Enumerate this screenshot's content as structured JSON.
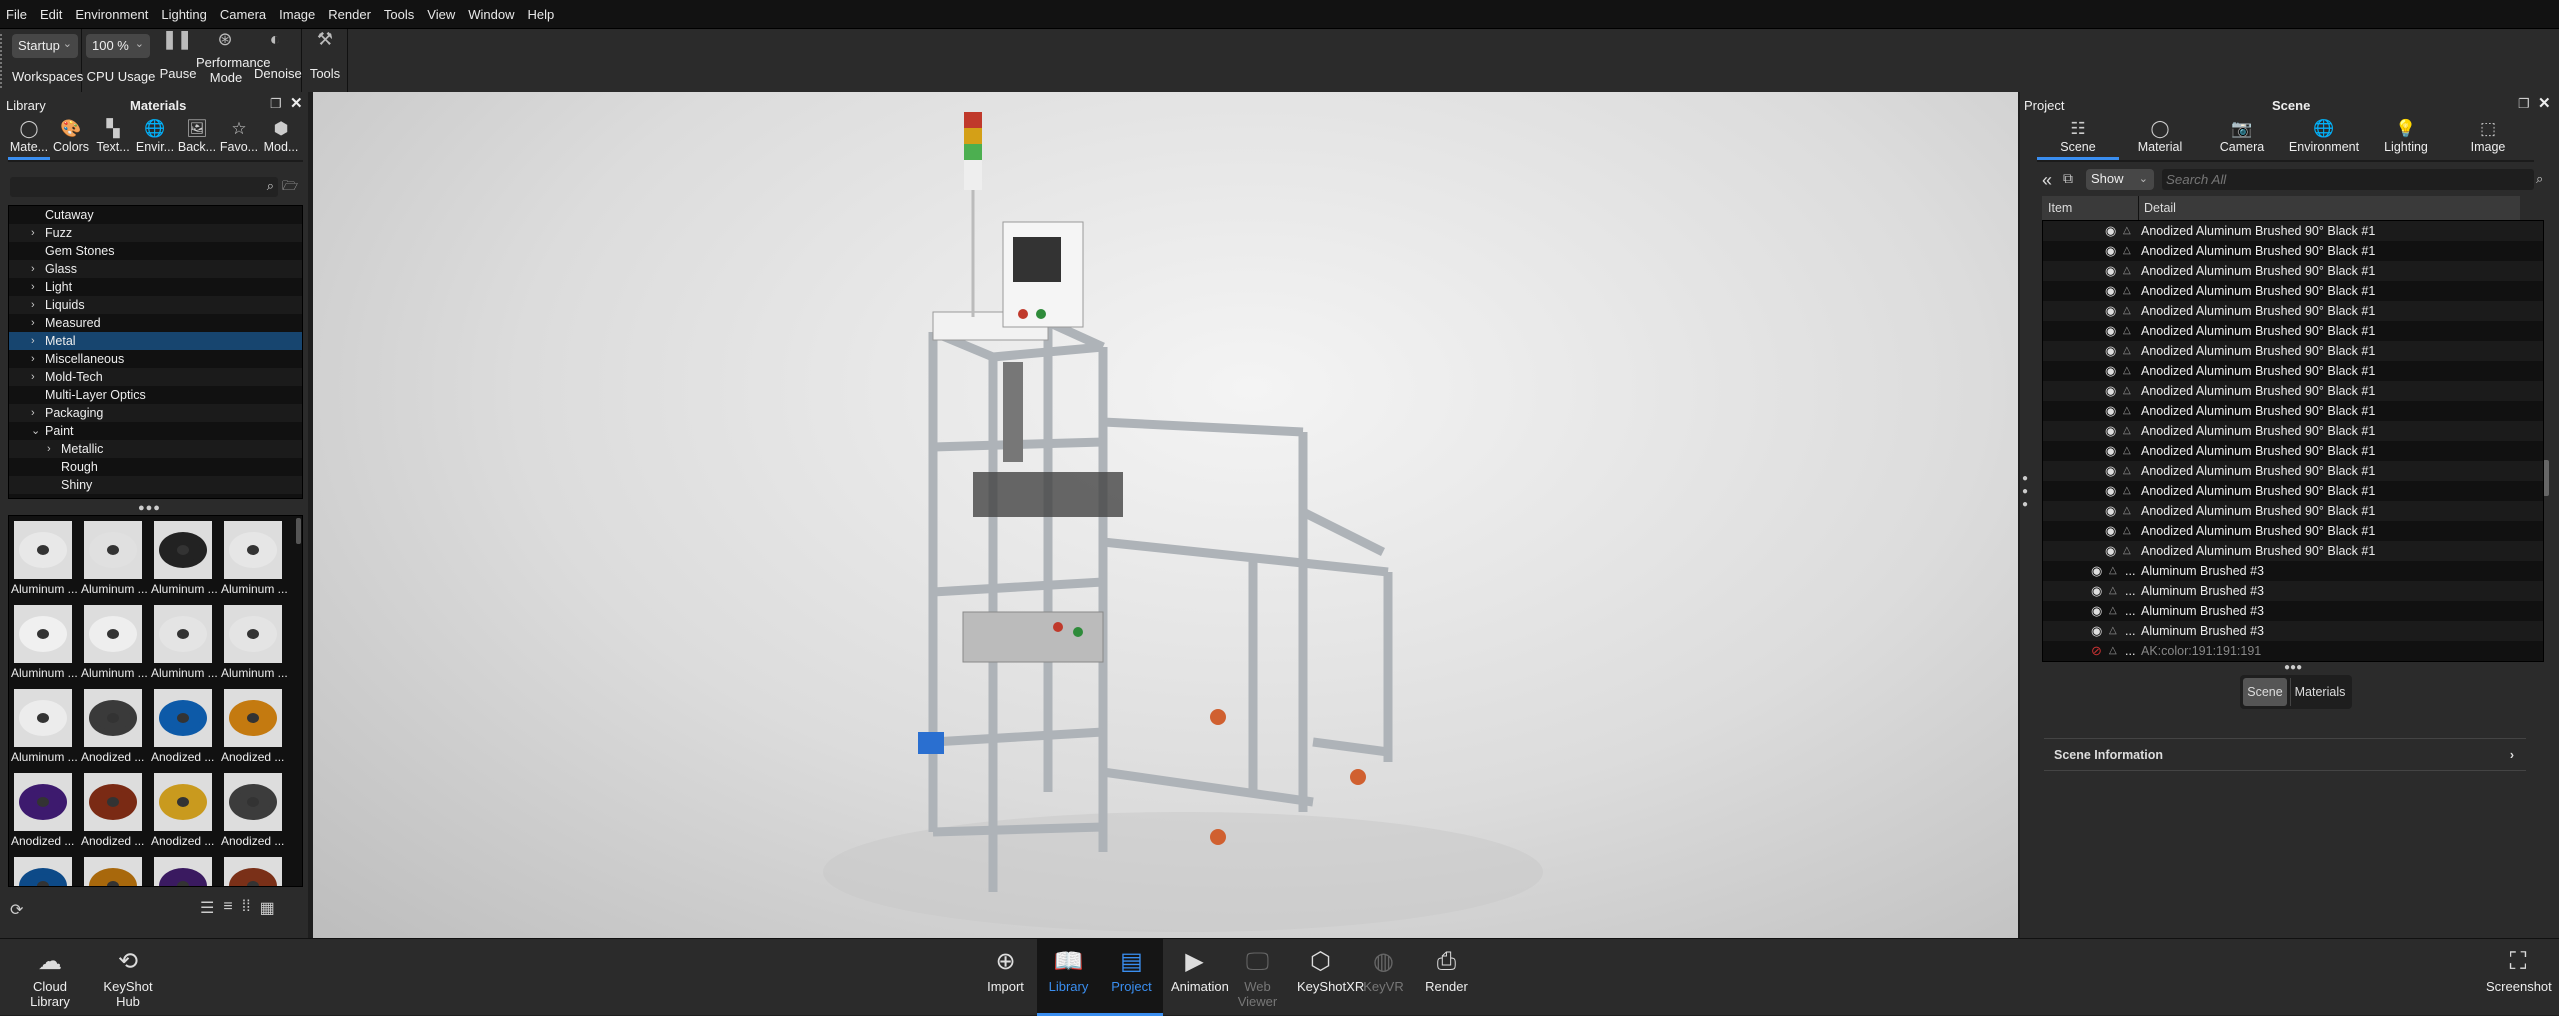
{
  "menu": [
    "File",
    "Edit",
    "Environment",
    "Lighting",
    "Camera",
    "Image",
    "Render",
    "Tools",
    "View",
    "Window",
    "Help"
  ],
  "toolbar": {
    "workspace_value": "Startup",
    "workspaces_label": "Workspaces",
    "cpu_value": "100 %",
    "cpu_label": "CPU Usage",
    "pause": "Pause",
    "performance": "Performance Mode",
    "denoise": "Denoise",
    "tools": "Tools"
  },
  "library": {
    "title": "Library",
    "subtitle": "Materials",
    "tabs": [
      {
        "label": "Mate...",
        "icon": "material-icon"
      },
      {
        "label": "Colors",
        "icon": "palette-icon"
      },
      {
        "label": "Text...",
        "icon": "texture-icon"
      },
      {
        "label": "Envir...",
        "icon": "globe-icon"
      },
      {
        "label": "Back...",
        "icon": "image-icon"
      },
      {
        "label": "Favo...",
        "icon": "star-icon"
      },
      {
        "label": "Mod...",
        "icon": "cubes-icon"
      }
    ],
    "search_value": "",
    "tree": [
      {
        "label": "Cutaway",
        "arrow": ""
      },
      {
        "label": "Fuzz",
        "arrow": ">"
      },
      {
        "label": "Gem Stones",
        "arrow": ""
      },
      {
        "label": "Glass",
        "arrow": ">"
      },
      {
        "label": "Light",
        "arrow": ">"
      },
      {
        "label": "Liquids",
        "arrow": ">"
      },
      {
        "label": "Measured",
        "arrow": ">"
      },
      {
        "label": "Metal",
        "arrow": ">",
        "selected": true
      },
      {
        "label": "Miscellaneous",
        "arrow": ">"
      },
      {
        "label": "Mold-Tech",
        "arrow": ">"
      },
      {
        "label": "Multi-Layer Optics",
        "arrow": ""
      },
      {
        "label": "Packaging",
        "arrow": ">"
      },
      {
        "label": "Paint",
        "arrow": "v"
      },
      {
        "label": "Metallic",
        "arrow": ">",
        "indent": 1
      },
      {
        "label": "Rough",
        "arrow": "",
        "indent": 1
      },
      {
        "label": "Shiny",
        "arrow": "",
        "indent": 1
      }
    ],
    "materials": [
      {
        "label": "Aluminum ...",
        "color": "#e8e8e8"
      },
      {
        "label": "Aluminum ...",
        "color": "#e0e0e0"
      },
      {
        "label": "Aluminum ...",
        "color": "#222222"
      },
      {
        "label": "Aluminum ...",
        "color": "#e6e6e6"
      },
      {
        "label": "Aluminum ...",
        "color": "#f0f0f0"
      },
      {
        "label": "Aluminum ...",
        "color": "#eeeeee"
      },
      {
        "label": "Aluminum ...",
        "color": "#e4e4e4"
      },
      {
        "label": "Aluminum ...",
        "color": "#e4e4e4"
      },
      {
        "label": "Aluminum ...",
        "color": "#ececec"
      },
      {
        "label": "Anodized ...",
        "color": "#3a3a3a"
      },
      {
        "label": "Anodized ...",
        "color": "#0d5aa8"
      },
      {
        "label": "Anodized ...",
        "color": "#c47a10"
      },
      {
        "label": "Anodized ...",
        "color": "#3d1a6e"
      },
      {
        "label": "Anodized ...",
        "color": "#7a2a14"
      },
      {
        "label": "Anodized ...",
        "color": "#c99a1e"
      },
      {
        "label": "Anodized ...",
        "color": "#3c3c3c"
      },
      {
        "label": "",
        "color": "#0d4a88"
      },
      {
        "label": "",
        "color": "#a8680c"
      },
      {
        "label": "",
        "color": "#3a1a60"
      },
      {
        "label": "",
        "color": "#7a3018"
      }
    ]
  },
  "project": {
    "title": "Project",
    "subtitle": "Scene",
    "tabs": [
      {
        "label": "Scene",
        "icon": "list-icon"
      },
      {
        "label": "Material",
        "icon": "material-icon"
      },
      {
        "label": "Camera",
        "icon": "camera-icon"
      },
      {
        "label": "Environment",
        "icon": "globe-icon"
      },
      {
        "label": "Lighting",
        "icon": "bulb-icon"
      },
      {
        "label": "Image",
        "icon": "frame-icon"
      }
    ],
    "show_value": "Show",
    "search_placeholder": "Search All",
    "columns": [
      "Item",
      "Detail"
    ],
    "rows": [
      {
        "detail": "Anodized Aluminum Brushed 90° Black #1"
      },
      {
        "detail": "Anodized Aluminum Brushed 90° Black #1"
      },
      {
        "detail": "Anodized Aluminum Brushed 90° Black #1"
      },
      {
        "detail": "Anodized Aluminum Brushed 90° Black #1"
      },
      {
        "detail": "Anodized Aluminum Brushed 90° Black #1"
      },
      {
        "detail": "Anodized Aluminum Brushed 90° Black #1"
      },
      {
        "detail": "Anodized Aluminum Brushed 90° Black #1"
      },
      {
        "detail": "Anodized Aluminum Brushed 90° Black #1"
      },
      {
        "detail": "Anodized Aluminum Brushed 90° Black #1"
      },
      {
        "detail": "Anodized Aluminum Brushed 90° Black #1"
      },
      {
        "detail": "Anodized Aluminum Brushed 90° Black #1"
      },
      {
        "detail": "Anodized Aluminum Brushed 90° Black #1"
      },
      {
        "detail": "Anodized Aluminum Brushed 90° Black #1"
      },
      {
        "detail": "Anodized Aluminum Brushed 90° Black #1"
      },
      {
        "detail": "Anodized Aluminum Brushed 90° Black #1"
      },
      {
        "detail": "Anodized Aluminum Brushed 90° Black #1"
      },
      {
        "detail": "Anodized Aluminum Brushed 90° Black #1"
      },
      {
        "prefix": "...",
        "detail": "Aluminum Brushed #3"
      },
      {
        "prefix": "...",
        "detail": "Aluminum Brushed #3"
      },
      {
        "prefix": "...",
        "detail": "Aluminum Brushed #3"
      },
      {
        "prefix": "...",
        "detail": "Aluminum Brushed #3"
      },
      {
        "prefix": "...",
        "detail": "AK:color:191:191:191",
        "hidden": true
      }
    ],
    "seg": [
      "Scene",
      "Materials"
    ],
    "scene_information": "Scene Information"
  },
  "bottom": {
    "left": [
      {
        "label": "Cloud Library",
        "icon": "cloud-icon"
      },
      {
        "label": "KeyShot Hub",
        "icon": "hub-icon"
      }
    ],
    "center": [
      {
        "label": "Import",
        "icon": "import-icon"
      },
      {
        "label": "Library",
        "icon": "book-icon",
        "active": true
      },
      {
        "label": "Project",
        "icon": "notebook-icon",
        "active": true
      },
      {
        "label": "Animation",
        "icon": "animation-icon"
      },
      {
        "label": "Web Viewer",
        "icon": "web-viewer-icon",
        "disabled": true
      },
      {
        "label": "KeyShotXR",
        "icon": "xr-cube-icon"
      },
      {
        "label": "KeyVR",
        "icon": "vr-headset-icon",
        "disabled": true
      },
      {
        "label": "Render",
        "icon": "render-icon"
      }
    ],
    "right": {
      "label": "Screenshot",
      "icon": "screenshot-icon"
    }
  },
  "colors": {
    "accent": "#3a8ef0",
    "selection": "#17456f"
  }
}
